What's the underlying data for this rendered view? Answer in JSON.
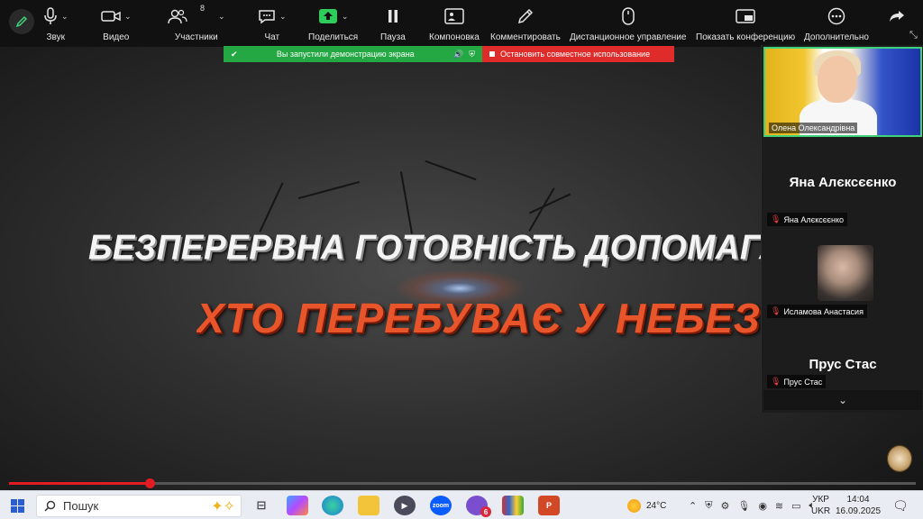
{
  "toolbar": {
    "items": [
      {
        "label": "Звук",
        "icon": "microphone-icon"
      },
      {
        "label": "Видео",
        "icon": "video-camera-icon"
      },
      {
        "label": "Участники",
        "icon": "participants-icon",
        "count": "8"
      },
      {
        "label": "Чат",
        "icon": "chat-icon"
      },
      {
        "label": "Поделиться",
        "icon": "share-screen-icon"
      },
      {
        "label": "Пауза",
        "icon": "pause-icon"
      },
      {
        "label": "Компоновка",
        "icon": "layout-icon"
      },
      {
        "label": "Комментировать",
        "icon": "annotate-pencil-icon"
      },
      {
        "label": "Дистанционное управление",
        "icon": "remote-control-mouse-icon"
      },
      {
        "label": "Показать конференцию",
        "icon": "show-meeting-icon"
      },
      {
        "label": "Дополнительно",
        "icon": "more-dots-icon"
      }
    ]
  },
  "share_banner": {
    "message": "Вы запустили демонстрацию экрана",
    "stop_label": "Остановить совместное использование"
  },
  "slide": {
    "line1": "БЕЗПЕРЕРВНА ГОТОВНІСТЬ ДОПОМАГАТИ ТИМ,",
    "line2": "ХТО ПЕРЕБУВАЄ У НЕБЕЗПЕЦІ"
  },
  "participants": {
    "video_tile_name": "Олена Олександрівна",
    "yana_big": "Яна Алєксєєнко",
    "yana_small": "Яна Алєксєєнко",
    "islamova_small": "Исламова Анастасия",
    "prus_big": "Прус Стас",
    "prus_small": "Прус Стас"
  },
  "playback": {
    "progress_fraction": 0.155
  },
  "taskbar": {
    "search_placeholder": "Пошук",
    "weather": "24°C",
    "lang_top": "УКР",
    "lang_bottom": "UKR",
    "time": "14:04",
    "date": "16.09.2025",
    "viber_badge": "6",
    "zoom_label": "zoom"
  },
  "colors": {
    "share_green": "#23a843",
    "stop_red": "#e02b2b",
    "progress_red": "#e31b23",
    "slide_orange": "#e8552a",
    "active_tile_border": "#3fd27a"
  }
}
